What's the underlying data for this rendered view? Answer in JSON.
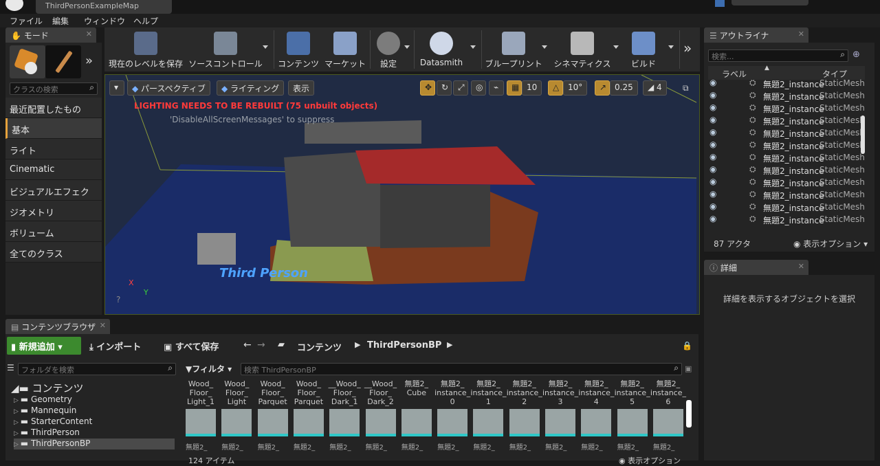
{
  "window": {
    "map_tab": "ThirdPersonExampleMap"
  },
  "menu": [
    "ファイル",
    "編集",
    "ウィンドウ",
    "ヘルプ"
  ],
  "modes": {
    "tab": "モード",
    "search_placeholder": "クラスの検索",
    "categories": [
      "最近配置したもの",
      "基本",
      "ライト",
      "Cinematic",
      "ビジュアルエフェクト",
      "ジオメトリ",
      "ボリューム",
      "全てのクラス"
    ],
    "selected_index": 1
  },
  "toolbar": {
    "buttons": [
      "現在のレベルを保存",
      "ソースコントロール",
      "コンテンツ",
      "マーケット",
      "設定",
      "Datasmith",
      "ブループリント",
      "シネマティクス",
      "ビルド"
    ]
  },
  "viewport": {
    "perspective": "パースペクティブ",
    "lighting": "ライティング",
    "show": "表示",
    "grid_snap": "10",
    "rot_snap": "10°",
    "scale_snap": "0.25",
    "cam_speed": "4",
    "warning": "LIGHTING NEEDS TO BE REBUILT (75 unbuilt objects)",
    "hint": "'DisableAllScreenMessages' to suppress",
    "scene_text": "Third Person",
    "axis_x": "X",
    "axis_y": "Y"
  },
  "outliner": {
    "tab": "アウトライナ",
    "search_placeholder": "検索...",
    "col_label": "ラベル",
    "col_type": "タイプ",
    "rows": [
      {
        "label": "無題2_instance",
        "type": "StaticMesh"
      },
      {
        "label": "無題2_instance",
        "type": "StaticMesh"
      },
      {
        "label": "無題2_instance",
        "type": "StaticMesh"
      },
      {
        "label": "無題2_instance",
        "type": "StaticMesh"
      },
      {
        "label": "無題2_instance",
        "type": "StaticMesh"
      },
      {
        "label": "無題2_instance",
        "type": "StaticMesh"
      },
      {
        "label": "無題2_instance",
        "type": "StaticMesh"
      },
      {
        "label": "無題2_instance",
        "type": "StaticMesh"
      },
      {
        "label": "無題2_instance",
        "type": "StaticMesh"
      },
      {
        "label": "無題2_instance",
        "type": "StaticMesh"
      },
      {
        "label": "無題2_instance",
        "type": "StaticMesh"
      },
      {
        "label": "無題2_instance",
        "type": "StaticMesh"
      }
    ],
    "actor_count": "87 アクタ",
    "view_options": "表示オプション"
  },
  "details": {
    "tab": "詳細",
    "empty_message": "詳細を表示するオブジェクトを選択"
  },
  "content_browser": {
    "tab": "コンテンツブラウザ",
    "add_new": "新規追加",
    "import": "インポート",
    "save_all": "すべて保存",
    "path": [
      "コンテンツ",
      "ThirdPersonBP"
    ],
    "folder_search_placeholder": "フォルダを検索",
    "filter": "フィルタ",
    "asset_search_placeholder": "検索 ThirdPersonBP",
    "root_folder": "コンテンツ",
    "folders": [
      "Geometry",
      "Mannequin",
      "StarterContent",
      "ThirdPerson",
      "ThirdPersonBP"
    ],
    "assets": [
      "Wood_\nFloor_\nLight_1",
      "Wood_\nFloor_\nLight",
      "Wood_\nFloor_\nParquet",
      "Wood_\nFloor_\nParquet",
      "__Wood_\nFloor_\nDark_1",
      "__Wood_\nFloor_\nDark_2",
      "無題2_\nCube",
      "無題2_\ninstance_\n0",
      "無題2_\ninstance_\n1",
      "無題2_\ninstance_\n2",
      "無題2_\ninstance_\n3",
      "無題2_\ninstance_\n4",
      "無題2_\ninstance_\n5",
      "無題2_\ninstance_\n6"
    ],
    "asset_sub": "無題2_",
    "item_count": "124 アイテム",
    "view_options": "表示オプション"
  },
  "colors": {
    "accent": "#e6a23c",
    "add_button": "#3c8a2e",
    "warning": "#ff3a3a",
    "highlight_cyan": "#2fc7c7"
  }
}
